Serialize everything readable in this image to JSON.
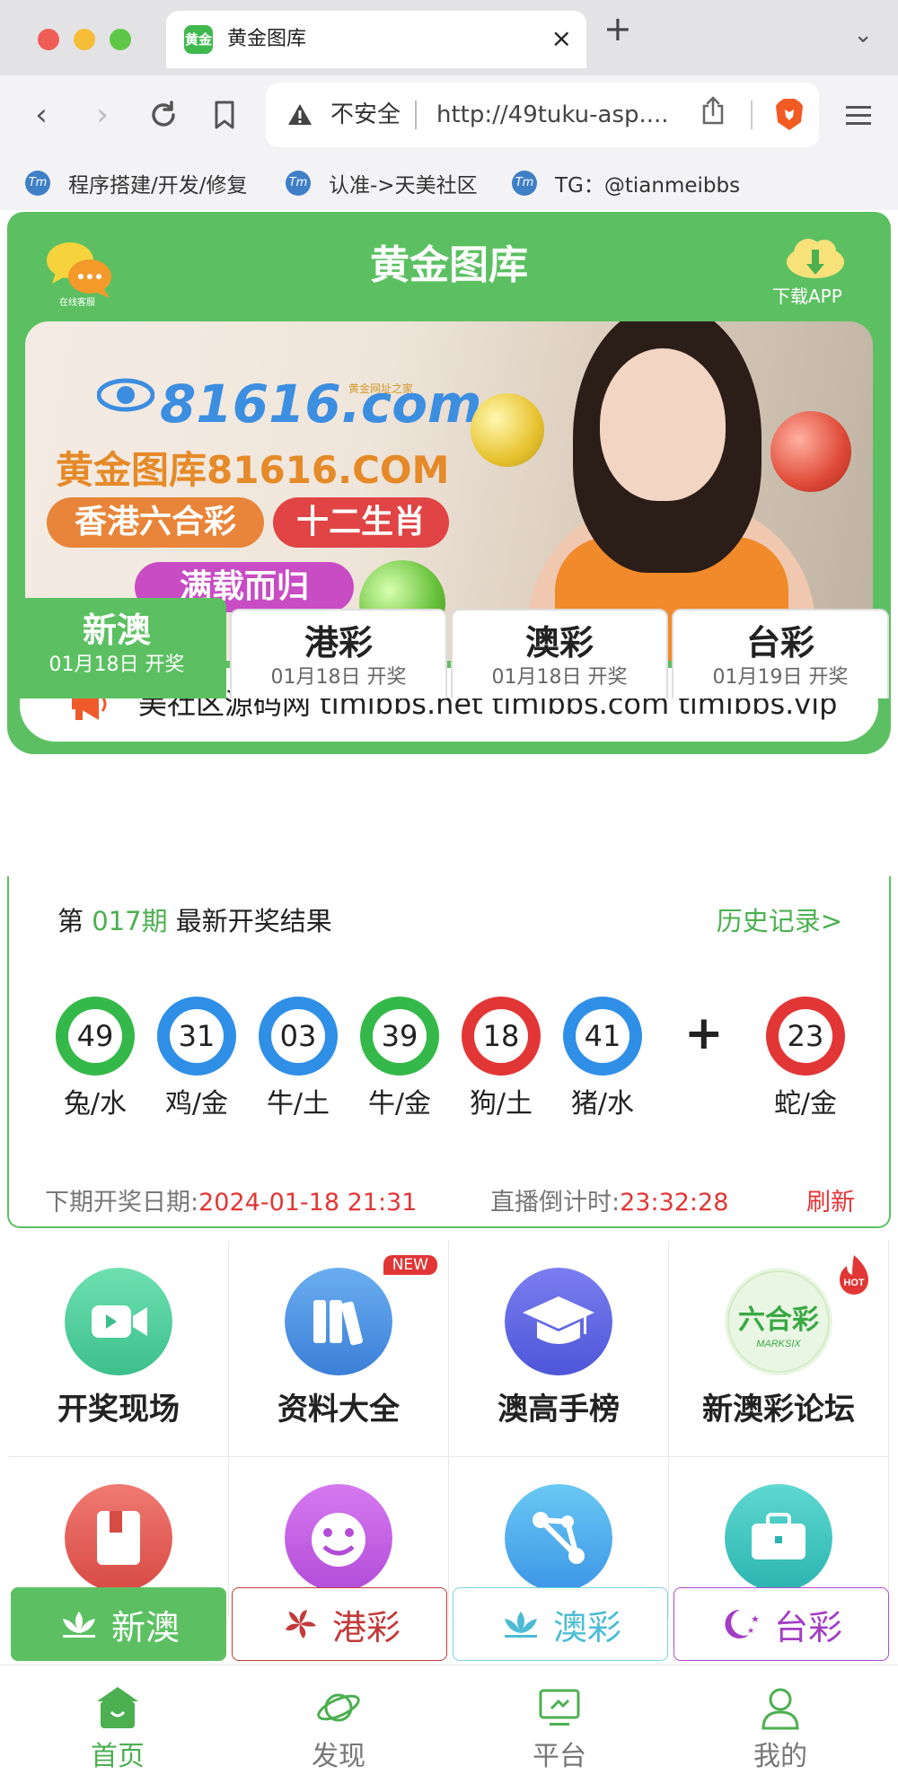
{
  "browser": {
    "tab_title": "黄金图库",
    "favicon_text": "黄金",
    "new_tab": "+",
    "insecure_label": "不安全",
    "url": "http://49tuku-asp....",
    "bookmarks": [
      {
        "icon": "Tm",
        "label": "程序搭建/开发/修复"
      },
      {
        "icon": "Tm",
        "label": "认准->天美社区"
      },
      {
        "icon": "Tm",
        "label": "TG：@tianmeibbs"
      }
    ]
  },
  "header": {
    "title": "黄金图库",
    "support_label": "在线客服",
    "download_label": "下载APP"
  },
  "banner": {
    "brand": "81616.com",
    "brand_sub": "黄金网址之家",
    "main": "黄金图库81616.COM",
    "pill1": "香港六合彩",
    "pill2": "十二生肖",
    "pill3": "满载而归"
  },
  "marquee": "美社区源码网 timibbs.net timibbs.com timibbs.vip",
  "lottery_tabs": [
    {
      "name": "新澳",
      "date": "01月18日 开奖"
    },
    {
      "name": "港彩",
      "date": "01月18日 开奖"
    },
    {
      "name": "澳彩",
      "date": "01月18日 开奖"
    },
    {
      "name": "台彩",
      "date": "01月19日 开奖"
    }
  ],
  "result": {
    "prefix": "第 ",
    "issue": "017期",
    "suffix": " 最新开奖结果",
    "history": "历史记录>",
    "balls": [
      {
        "num": "49",
        "zodiac": "兔/水",
        "color": "#35b84a"
      },
      {
        "num": "31",
        "zodiac": "鸡/金",
        "color": "#2f8fe6"
      },
      {
        "num": "03",
        "zodiac": "牛/土",
        "color": "#2f8fe6"
      },
      {
        "num": "39",
        "zodiac": "牛/金",
        "color": "#35b84a"
      },
      {
        "num": "18",
        "zodiac": "狗/土",
        "color": "#e23636"
      },
      {
        "num": "41",
        "zodiac": "猪/水",
        "color": "#2f8fe6"
      }
    ],
    "plus": "+",
    "special": {
      "num": "23",
      "zodiac": "蛇/金",
      "color": "#e23636"
    },
    "next_label": "下期开奖日期:",
    "next_date": "2024-01-18 21:31",
    "countdown_label": "直播倒计时:",
    "countdown": "23:32:28",
    "refresh": "刷新"
  },
  "grid": {
    "row1": [
      {
        "label": "开奖现场",
        "icon": "video-icon"
      },
      {
        "label": "资料大全",
        "icon": "books-icon",
        "badge": "NEW"
      },
      {
        "label": "澳高手榜",
        "icon": "graduation-cap-icon"
      },
      {
        "label": "新澳彩论坛",
        "icon": "marksix-icon",
        "badge": "HOT"
      }
    ],
    "row2": [
      {
        "icon": "book-icon"
      },
      {
        "icon": "clown-icon"
      },
      {
        "icon": "network-icon"
      },
      {
        "icon": "briefcase-icon"
      }
    ]
  },
  "region_buttons": [
    {
      "label": "新澳",
      "icon": "lotus-icon"
    },
    {
      "label": "港彩",
      "icon": "bauhinia-icon"
    },
    {
      "label": "澳彩",
      "icon": "lotus-icon"
    },
    {
      "label": "台彩",
      "icon": "moon-stars-icon"
    }
  ],
  "bottom_nav": [
    {
      "label": "首页",
      "icon": "home-icon"
    },
    {
      "label": "发现",
      "icon": "planet-icon"
    },
    {
      "label": "平台",
      "icon": "monitor-icon"
    },
    {
      "label": "我的",
      "icon": "user-icon"
    }
  ],
  "colors": {
    "brand_green": "#5cc062",
    "red": "#e23636",
    "blue": "#2f8fe6"
  }
}
